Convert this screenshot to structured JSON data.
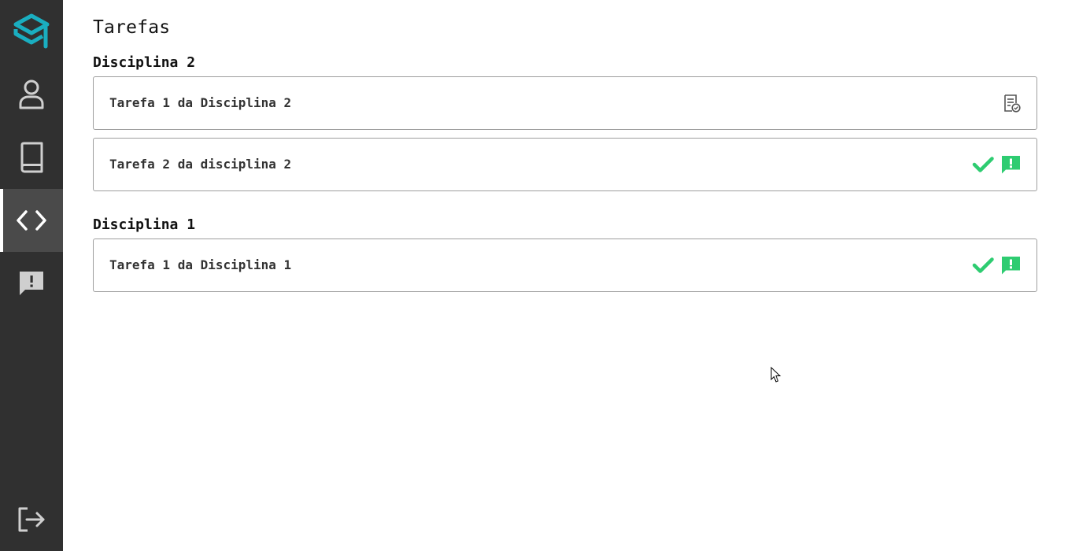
{
  "sidebar": {
    "logo_icon": "graduation-cap-logo-icon",
    "accent_color": "#1aaec0",
    "items": [
      {
        "name": "profile",
        "icon": "user-icon",
        "active": false
      },
      {
        "name": "subjects",
        "icon": "book-icon",
        "active": false
      },
      {
        "name": "tasks",
        "icon": "code-icon",
        "active": true
      },
      {
        "name": "feedback",
        "icon": "message-alert-icon",
        "active": false
      }
    ],
    "logout_icon": "logout-icon"
  },
  "main": {
    "title": "Tarefas",
    "sections": [
      {
        "title": "Disciplina 2",
        "tasks": [
          {
            "label": "Tarefa 1 da Disciplina 2",
            "status_icons": [
              "submission-pending-icon"
            ]
          },
          {
            "label": "Tarefa 2 da disciplina 2",
            "status_icons": [
              "check-icon",
              "feedback-icon"
            ]
          }
        ]
      },
      {
        "title": "Disciplina 1",
        "tasks": [
          {
            "label": "Tarefa 1 da Disciplina 1",
            "status_icons": [
              "check-icon",
              "feedback-icon"
            ]
          }
        ]
      }
    ]
  },
  "colors": {
    "sidebar_bg": "#303030",
    "sidebar_active_bg": "#4a4a4a",
    "success_green": "#2ecc71",
    "card_border": "#9e9e9e"
  }
}
